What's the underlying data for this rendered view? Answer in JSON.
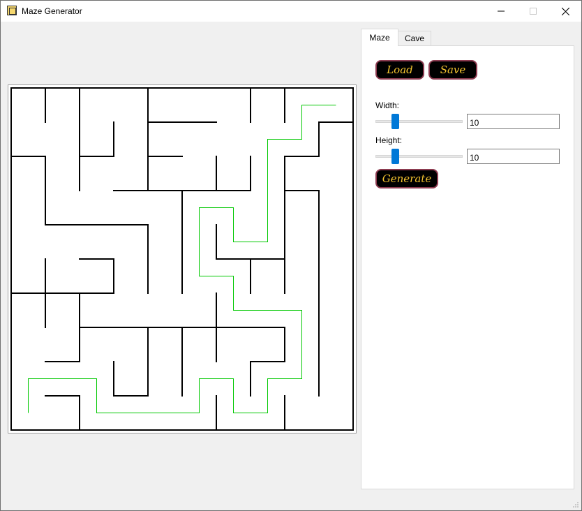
{
  "window": {
    "title": "Maze Generator",
    "icon": "maze-app-icon",
    "controls": {
      "minimize": "—",
      "maximize": "☐",
      "close": "✕"
    }
  },
  "tabs": [
    {
      "label": "Maze",
      "selected": true
    },
    {
      "label": "Cave",
      "selected": false
    }
  ],
  "maze_tab": {
    "load_label": "Load",
    "save_label": "Save",
    "width_label": "Width:",
    "width_value": "10",
    "width_slider_fraction": 0.2,
    "height_label": "Height:",
    "height_value": "10",
    "height_slider_fraction": 0.2,
    "generate_label": "Generate"
  },
  "maze": {
    "cols": 10,
    "rows": 10,
    "wall_color": "#000000",
    "path_color": "#00c800",
    "walls": [
      [
        [
          0,
          0
        ],
        [
          10,
          0
        ]
      ],
      [
        [
          0,
          10
        ],
        [
          10,
          10
        ]
      ],
      [
        [
          0,
          0
        ],
        [
          0,
          10
        ]
      ],
      [
        [
          10,
          0
        ],
        [
          10,
          10
        ]
      ],
      [
        [
          1,
          0
        ],
        [
          1,
          1
        ]
      ],
      [
        [
          2,
          0
        ],
        [
          2,
          3
        ]
      ],
      [
        [
          4,
          0
        ],
        [
          4,
          3
        ]
      ],
      [
        [
          7,
          0
        ],
        [
          7,
          1
        ]
      ],
      [
        [
          8,
          0
        ],
        [
          8,
          1
        ]
      ],
      [
        [
          4,
          1
        ],
        [
          6,
          1
        ]
      ],
      [
        [
          3,
          1
        ],
        [
          3,
          2
        ]
      ],
      [
        [
          9,
          1
        ],
        [
          10,
          1
        ]
      ],
      [
        [
          9,
          1
        ],
        [
          9,
          2
        ]
      ],
      [
        [
          0,
          2
        ],
        [
          1,
          2
        ]
      ],
      [
        [
          1,
          2
        ],
        [
          1,
          4
        ]
      ],
      [
        [
          2,
          2
        ],
        [
          3,
          2
        ]
      ],
      [
        [
          4,
          2
        ],
        [
          5,
          2
        ]
      ],
      [
        [
          6,
          2
        ],
        [
          6,
          3
        ]
      ],
      [
        [
          7,
          2
        ],
        [
          7,
          3
        ]
      ],
      [
        [
          8,
          2
        ],
        [
          9,
          2
        ]
      ],
      [
        [
          8,
          2
        ],
        [
          8,
          6
        ]
      ],
      [
        [
          3,
          3
        ],
        [
          7,
          3
        ]
      ],
      [
        [
          5,
          3
        ],
        [
          5,
          6
        ]
      ],
      [
        [
          8,
          3
        ],
        [
          9,
          3
        ]
      ],
      [
        [
          9,
          3
        ],
        [
          9,
          9
        ]
      ],
      [
        [
          1,
          4
        ],
        [
          4,
          4
        ]
      ],
      [
        [
          4,
          4
        ],
        [
          4,
          6
        ]
      ],
      [
        [
          6,
          4
        ],
        [
          6,
          5
        ]
      ],
      [
        [
          6,
          5
        ],
        [
          8,
          5
        ]
      ],
      [
        [
          1,
          5
        ],
        [
          1,
          7
        ]
      ],
      [
        [
          2,
          5
        ],
        [
          3,
          5
        ]
      ],
      [
        [
          3,
          5
        ],
        [
          3,
          6
        ]
      ],
      [
        [
          7,
          5
        ],
        [
          7,
          6
        ]
      ],
      [
        [
          0,
          6
        ],
        [
          3,
          6
        ]
      ],
      [
        [
          2,
          6
        ],
        [
          2,
          7
        ]
      ],
      [
        [
          6,
          6
        ],
        [
          6,
          8
        ]
      ],
      [
        [
          2,
          7
        ],
        [
          8,
          7
        ]
      ],
      [
        [
          2,
          7
        ],
        [
          2,
          8
        ]
      ],
      [
        [
          4,
          7
        ],
        [
          4,
          9
        ]
      ],
      [
        [
          5,
          7
        ],
        [
          5,
          9
        ]
      ],
      [
        [
          8,
          7
        ],
        [
          8,
          8
        ]
      ],
      [
        [
          1,
          8
        ],
        [
          2,
          8
        ]
      ],
      [
        [
          3,
          8
        ],
        [
          3,
          9
        ]
      ],
      [
        [
          7,
          8
        ],
        [
          8,
          8
        ]
      ],
      [
        [
          7,
          8
        ],
        [
          7,
          9
        ]
      ],
      [
        [
          1,
          9
        ],
        [
          2,
          9
        ]
      ],
      [
        [
          2,
          9
        ],
        [
          2,
          10
        ]
      ],
      [
        [
          3,
          9
        ],
        [
          4,
          9
        ]
      ],
      [
        [
          6,
          9
        ],
        [
          6,
          10
        ]
      ],
      [
        [
          8,
          9
        ],
        [
          8,
          10
        ]
      ]
    ],
    "solution": [
      [
        0.5,
        9.5
      ],
      [
        0.5,
        8.5
      ],
      [
        2.5,
        8.5
      ],
      [
        2.5,
        9.5
      ],
      [
        5.5,
        9.5
      ],
      [
        5.5,
        8.5
      ],
      [
        6.5,
        8.5
      ],
      [
        6.5,
        9.5
      ],
      [
        7.5,
        9.5
      ],
      [
        7.5,
        8.5
      ],
      [
        8.5,
        8.5
      ],
      [
        8.5,
        6.5
      ],
      [
        6.5,
        6.5
      ],
      [
        6.5,
        5.5
      ],
      [
        5.5,
        5.5
      ],
      [
        5.5,
        3.5
      ],
      [
        6.5,
        3.5
      ],
      [
        6.5,
        4.5
      ],
      [
        7.5,
        4.5
      ],
      [
        7.5,
        1.5
      ],
      [
        8.5,
        1.5
      ],
      [
        8.5,
        0.5
      ],
      [
        9.5,
        0.5
      ]
    ]
  }
}
